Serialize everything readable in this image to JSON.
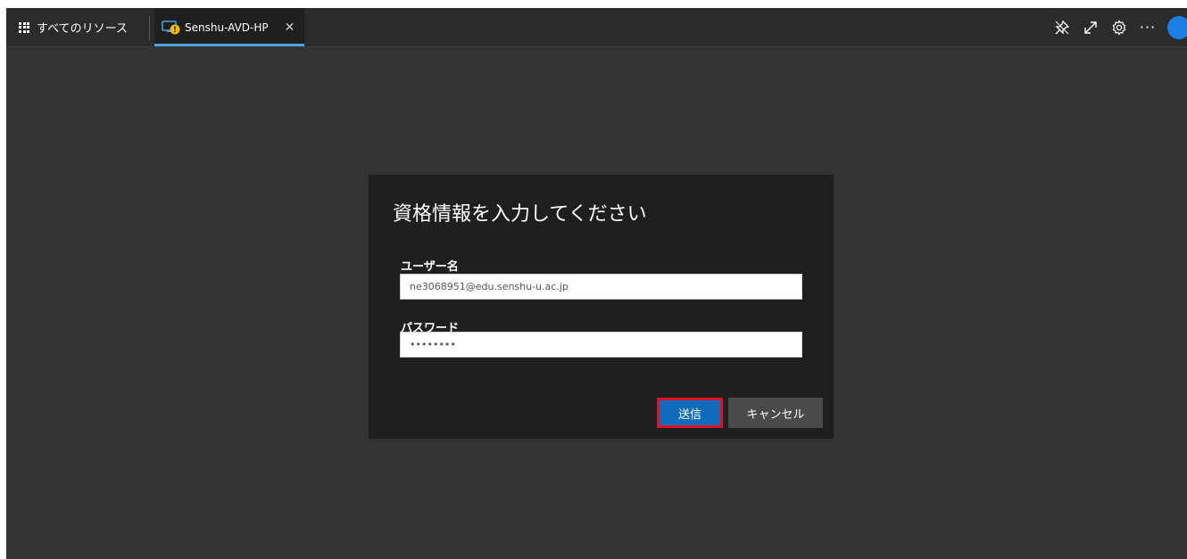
{
  "topbar": {
    "all_resources_label": "すべてのリソース",
    "tab_label": "Senshu-AVD-HP",
    "tab_close": "✕",
    "more": "···",
    "accent_color": "#4aa3df",
    "avatar_color": "#1a7fe0"
  },
  "dialog": {
    "title": "資格情報を入力してください",
    "username_label": "ユーザー名",
    "username_value": "ne3068951@edu.senshu-u.ac.jp",
    "password_label": "パスワード",
    "password_value": "••••••••",
    "submit_label": "送信",
    "cancel_label": "キャンセル",
    "submit_color": "#0f6cbd",
    "highlight_color": "#e01020"
  }
}
